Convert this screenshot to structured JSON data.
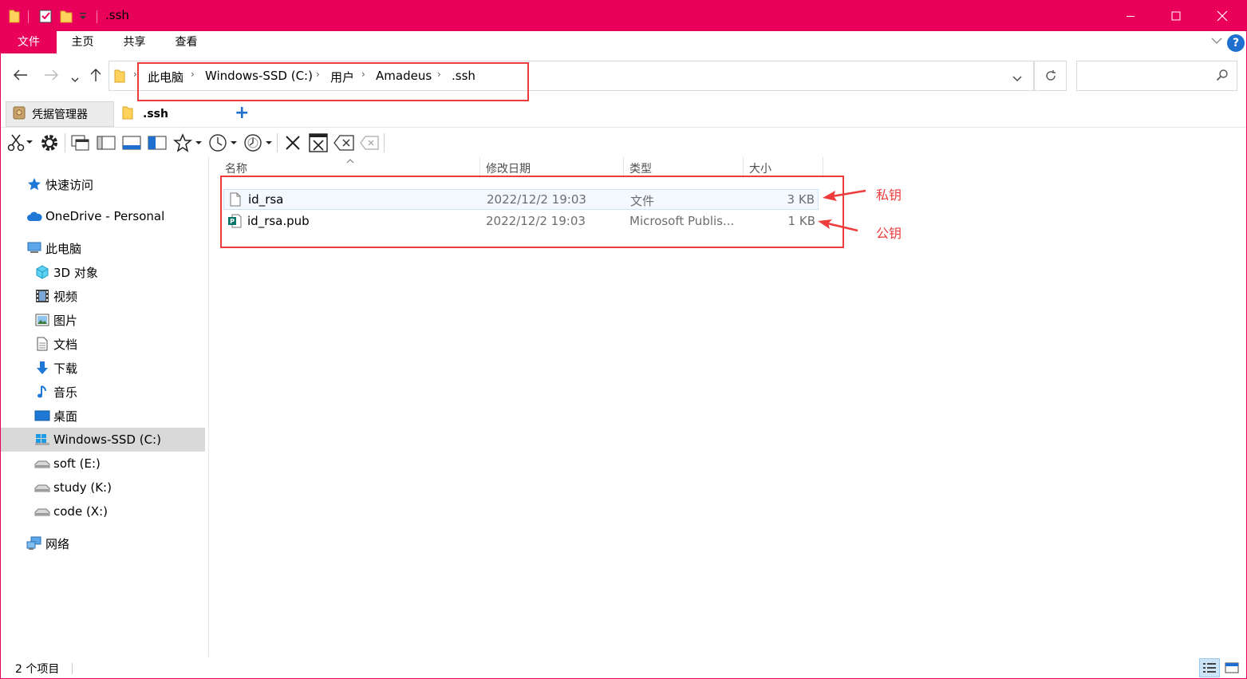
{
  "window": {
    "title": ".ssh",
    "colors": {
      "accent": "#e8005b",
      "annotation": "#ee3b3b",
      "selection": "#d9d9d9"
    }
  },
  "ribbon": {
    "tabs": [
      {
        "label": "文件",
        "active": true
      },
      {
        "label": "主页",
        "active": false
      },
      {
        "label": "共享",
        "active": false
      },
      {
        "label": "查看",
        "active": false
      }
    ],
    "help_label": "?"
  },
  "address": {
    "breadcrumbs": [
      "此电脑",
      "Windows-SSD (C:)",
      "用户",
      "Amadeus",
      ".ssh"
    ],
    "search_placeholder": ""
  },
  "folder_tabs": [
    {
      "label": "凭据管理器",
      "icon": "credential-manager-icon",
      "active": false
    },
    {
      "label": ".ssh",
      "icon": "folder-icon",
      "active": true
    }
  ],
  "toolbar": {
    "icons": [
      "scissors-icon",
      "gear-icon",
      "copy-window-icon",
      "layout-icon",
      "preview-pane-icon",
      "details-pane-icon",
      "star-icon",
      "clock-icon",
      "history-icon",
      "delete-icon",
      "close-box-icon",
      "backspace-icon",
      "clear-icon"
    ]
  },
  "nav": {
    "items": [
      {
        "label": "快速访问",
        "icon": "star-pin-icon",
        "indent": 1,
        "selected": false
      },
      {
        "label": "OneDrive - Personal",
        "icon": "cloud-icon",
        "indent": 1,
        "selected": false
      },
      {
        "label": "此电脑",
        "icon": "computer-icon",
        "indent": 1,
        "selected": false
      },
      {
        "label": "3D 对象",
        "icon": "cube-icon",
        "indent": 2,
        "selected": false
      },
      {
        "label": "视频",
        "icon": "film-icon",
        "indent": 2,
        "selected": false
      },
      {
        "label": "图片",
        "icon": "picture-icon",
        "indent": 2,
        "selected": false
      },
      {
        "label": "文档",
        "icon": "document-icon",
        "indent": 2,
        "selected": false
      },
      {
        "label": "下载",
        "icon": "download-arrow-icon",
        "indent": 2,
        "selected": false
      },
      {
        "label": "音乐",
        "icon": "music-note-icon",
        "indent": 2,
        "selected": false
      },
      {
        "label": "桌面",
        "icon": "desktop-icon",
        "indent": 2,
        "selected": false
      },
      {
        "label": "Windows-SSD (C:)",
        "icon": "windows-drive-icon",
        "indent": 2,
        "selected": true
      },
      {
        "label": "soft (E:)",
        "icon": "drive-icon",
        "indent": 2,
        "selected": false
      },
      {
        "label": "study (K:)",
        "icon": "drive-icon",
        "indent": 2,
        "selected": false
      },
      {
        "label": "code (X:)",
        "icon": "drive-icon",
        "indent": 2,
        "selected": false
      },
      {
        "label": "网络",
        "icon": "network-icon",
        "indent": 1,
        "selected": false
      }
    ]
  },
  "files": {
    "columns": [
      "名称",
      "修改日期",
      "类型",
      "大小"
    ],
    "rows": [
      {
        "name": "id_rsa",
        "date": "2022/12/2 19:03",
        "type": "文件",
        "size": "3 KB",
        "icon": "blank-file-icon"
      },
      {
        "name": "id_rsa.pub",
        "date": "2022/12/2 19:03",
        "type": "Microsoft Publis...",
        "size": "1 KB",
        "icon": "publisher-file-icon"
      }
    ]
  },
  "annotations": {
    "private_key": "私钥",
    "public_key": "公钥"
  },
  "status": {
    "item_count": "2 个项目"
  }
}
